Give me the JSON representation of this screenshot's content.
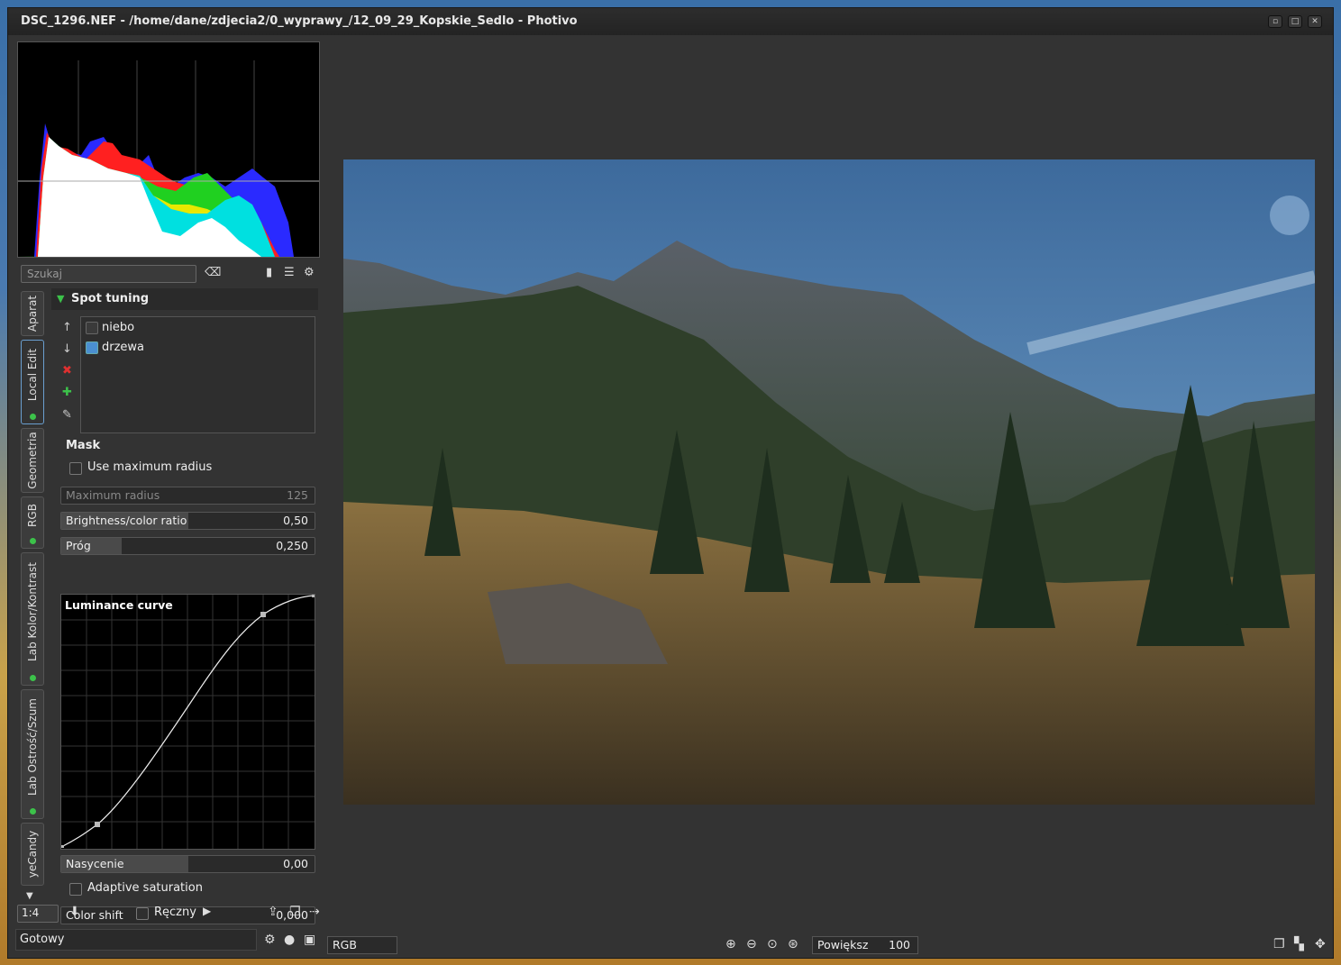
{
  "window": {
    "title": "DSC_1296.NEF - /home/dane/zdjecia2/0_wyprawy_/12_09_29_Kopskie_Sedlo - Photivo",
    "min": "▫",
    "max": "□",
    "close": "✕"
  },
  "search": {
    "placeholder": "Szukaj"
  },
  "tabs": [
    {
      "label": "Aparat"
    },
    {
      "label": "Local Edit"
    },
    {
      "label": "Geometria"
    },
    {
      "label": "RGB"
    },
    {
      "label": "Lab Kolor/Kontrast"
    },
    {
      "label": "Lab Ostrość/Szum"
    },
    {
      "label": "yeCandy"
    }
  ],
  "section": {
    "title": "Spot tuning"
  },
  "spots": [
    {
      "label": "niebo",
      "checked": false
    },
    {
      "label": "drzewa",
      "checked": true
    }
  ],
  "mask": {
    "title": "Mask",
    "use_max_radius": "Use maximum radius"
  },
  "sliders": {
    "max_radius": {
      "label": "Maximum radius",
      "value": "125",
      "fraction": 0
    },
    "brightness": {
      "label": "Brightness/color ratio",
      "value": "0,50",
      "fraction": 0.5
    },
    "prog": {
      "label": "Próg",
      "value": "0,250",
      "fraction": 0.25
    },
    "nasycenie": {
      "label": "Nasycenie",
      "value": "0,00",
      "fraction": 0.5
    },
    "color_shift": {
      "label": "Color shift",
      "value": "0,000",
      "fraction": 0
    }
  },
  "curve": {
    "title": "Luminance curve"
  },
  "adaptive_saturation": "Adaptive saturation",
  "bottom": {
    "zoom": "1:4",
    "manual": "Ręczny",
    "status": "Gotowy",
    "colorspace": "RGB",
    "zoom_label": "Powiększ",
    "zoom_value": "100"
  },
  "colors": {
    "accent": "#3cc24a",
    "tab_highlight": "#6a9fd0",
    "sky": "#4a7aa8"
  }
}
